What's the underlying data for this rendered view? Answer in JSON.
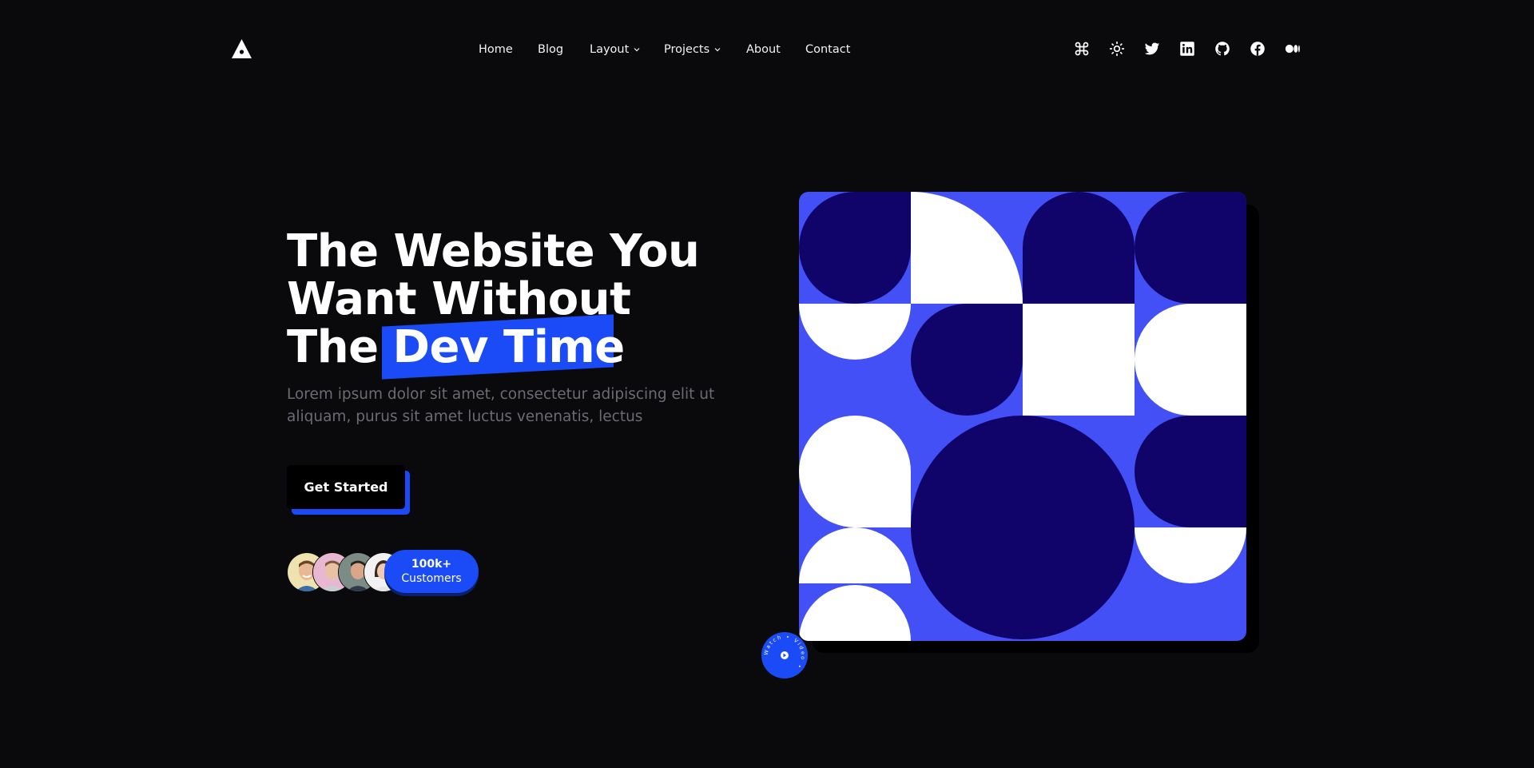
{
  "nav": {
    "items": [
      {
        "label": "Home"
      },
      {
        "label": "Blog"
      },
      {
        "label": "Layout",
        "dropdown": true
      },
      {
        "label": "Projects",
        "dropdown": true
      },
      {
        "label": "About"
      },
      {
        "label": "Contact"
      }
    ]
  },
  "header_icons": [
    "command-icon",
    "sun-icon",
    "twitter-icon",
    "linkedin-icon",
    "github-icon",
    "facebook-icon",
    "medium-icon"
  ],
  "hero": {
    "title_line1": "The Website You",
    "title_line2": "Want Without",
    "title_line3_prefix": "The",
    "title_highlight": "Dev Time",
    "subtitle": "Lorem ipsum dolor sit amet, consectetur adipiscing elit ut aliquam, purus sit amet luctus venenatis, lectus",
    "cta_label": "Get Started"
  },
  "customers": {
    "count": "100k+",
    "label": "Customers"
  },
  "badge": {
    "ring_text": "Watch • Video •"
  },
  "colors": {
    "background": "#0a0a0c",
    "accent": "#1a4bf7",
    "art_blue": "#4350f5",
    "art_navy": "#10046a",
    "muted_text": "#6b6b73"
  }
}
